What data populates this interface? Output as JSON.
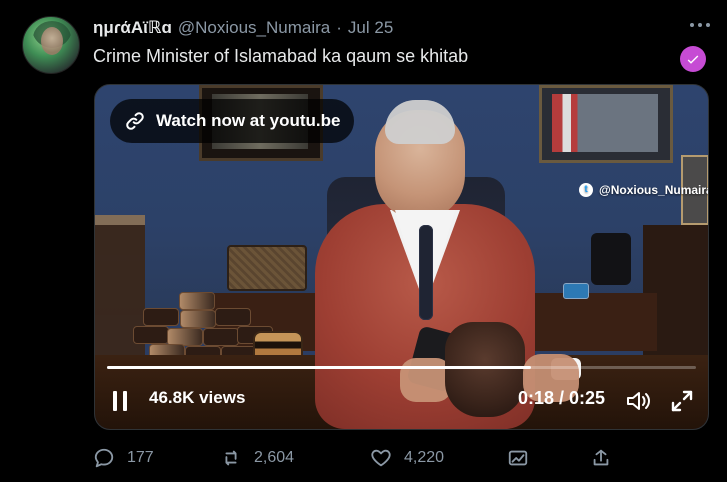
{
  "tweet": {
    "author": {
      "display_name": "ημɾάΑϊℝɑ",
      "handle": "@Noxious_Numaira",
      "dot": "·",
      "date": "Jul 25"
    },
    "text": "Crime Minister of Islamabad ka qaum se khitab",
    "verified_color": "#c64bd4",
    "more_icon": "more-horizontal-icon"
  },
  "video": {
    "cta_label": "Watch now at youtu.be",
    "watermark": "@Noxious_Numaira",
    "views": "46.8K views",
    "time": "0:18 / 0:25",
    "progress_fraction": 0.72,
    "icons": {
      "link": "link-icon",
      "pause": "pause-icon",
      "volume": "volume-icon",
      "fullscreen": "fullscreen-icon"
    }
  },
  "actions": {
    "reply_count": "177",
    "retweet_count": "2,604",
    "like_count": "4,220",
    "icons": {
      "reply": "reply-icon",
      "retweet": "retweet-icon",
      "like": "heart-icon",
      "stats": "analytics-icon",
      "share": "share-icon"
    }
  },
  "theme": {
    "background": "#000000",
    "text_primary": "#e7e9ea",
    "text_secondary": "#8b98a5"
  }
}
